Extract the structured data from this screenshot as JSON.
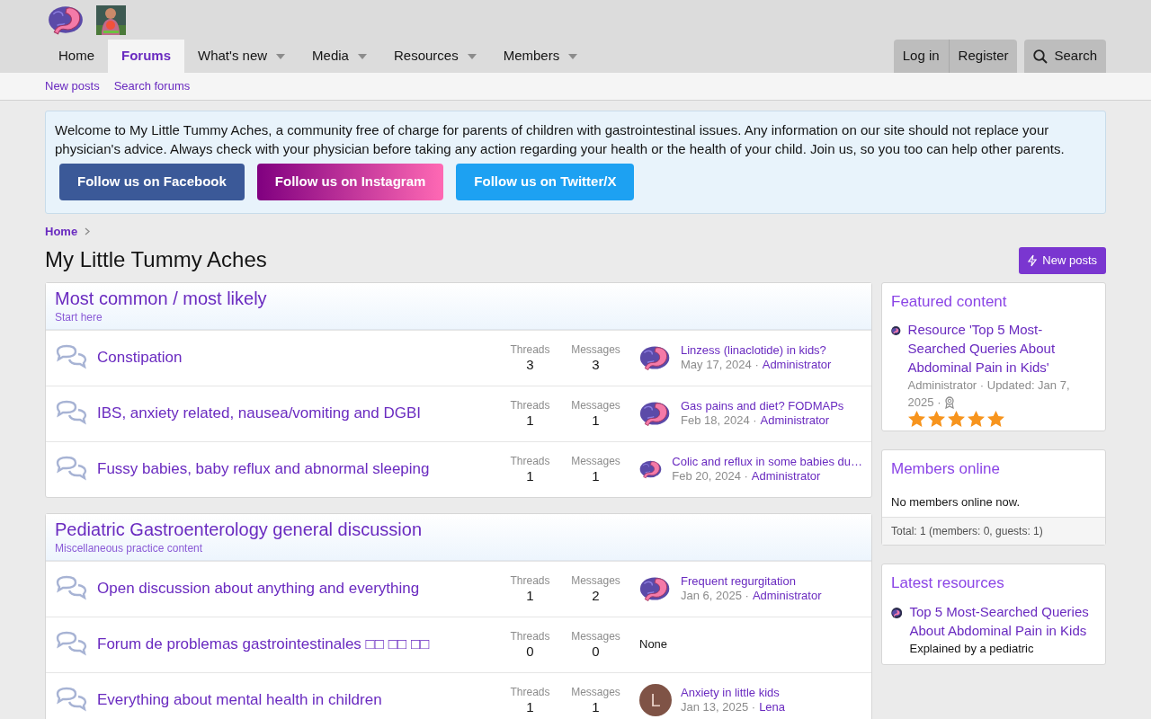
{
  "header": {
    "nav": [
      {
        "label": "Home",
        "selected": false,
        "has_menu": false
      },
      {
        "label": "Forums",
        "selected": true,
        "has_menu": false
      },
      {
        "label": "What's new",
        "selected": false,
        "has_menu": true
      },
      {
        "label": "Media",
        "selected": false,
        "has_menu": true
      },
      {
        "label": "Resources",
        "selected": false,
        "has_menu": true
      },
      {
        "label": "Members",
        "selected": false,
        "has_menu": true
      }
    ],
    "account_buttons": [
      "Log in",
      "Register"
    ],
    "search_button": "Search"
  },
  "subnav": [
    "New posts",
    "Search forums"
  ],
  "notice": {
    "text": "Welcome to My Little Tummy Aches, a community free of charge for parents of children with gastrointestinal issues. Any information on our site should not replace your physician's advice. Always check with your physician before taking any action regarding your health or the health of your child. Join us, so you too can help other parents.",
    "buttons": [
      {
        "label": "Follow us on Facebook",
        "kind": "facebook"
      },
      {
        "label": "Follow us on Instagram",
        "kind": "instagram"
      },
      {
        "label": "Follow us on Twitter/X",
        "kind": "twitter"
      }
    ]
  },
  "breadcrumb": [
    "Home"
  ],
  "page_title": "My Little Tummy Aches",
  "new_posts_button": "New posts",
  "categories": [
    {
      "title": "Most common / most likely",
      "description": "Start here",
      "forums": [
        {
          "title": "Constipation",
          "threads_label": "Threads",
          "threads": "3",
          "messages_label": "Messages",
          "messages": "3",
          "last_post": {
            "title": "Linzess (linaclotide) in kids?",
            "date": "May 17, 2024 ·",
            "author": "Administrator",
            "avatar": {
              "kind": "logo"
            }
          }
        },
        {
          "title": "IBS, anxiety related, nausea/vomiting and DGBI",
          "threads_label": "Threads",
          "threads": "1",
          "messages_label": "Messages",
          "messages": "1",
          "last_post": {
            "title": "Gas pains and diet? FODMAPs",
            "date": "Feb 18, 2024 ·",
            "author": "Administrator",
            "avatar": {
              "kind": "logo"
            }
          }
        },
        {
          "title": "Fussy babies, baby reflux and abnormal sleeping",
          "threads_label": "Threads",
          "threads": "1",
          "messages_label": "Messages",
          "messages": "1",
          "last_post": {
            "title": "Colic and reflux in some babies du…",
            "date": "Feb 20, 2024 ·",
            "author": "Administrator",
            "avatar": {
              "kind": "logo"
            }
          }
        }
      ]
    },
    {
      "title": "Pediatric Gastroenterology general discussion",
      "description": "Miscellaneous practice content",
      "forums": [
        {
          "title": "Open discussion about anything and everything",
          "threads_label": "Threads",
          "threads": "1",
          "messages_label": "Messages",
          "messages": "2",
          "last_post": {
            "title": "Frequent regurgitation",
            "date": "Jan 6, 2025 ·",
            "author": "Administrator",
            "avatar": {
              "kind": "logo"
            }
          }
        },
        {
          "title": "Forum de problemas gastrointestinales □□ □□ □□",
          "threads_label": "Threads",
          "threads": "0",
          "messages_label": "Messages",
          "messages": "0",
          "no_post": "None"
        },
        {
          "title": "Everything about mental health in children",
          "threads_label": "Threads",
          "threads": "1",
          "messages_label": "Messages",
          "messages": "1",
          "last_post": {
            "title": "Anxiety in little kids",
            "date": "Jan 13, 2025 ·",
            "author": "Lena",
            "avatar": {
              "kind": "letter",
              "letter": "L"
            }
          }
        }
      ]
    }
  ],
  "sidebar": {
    "featured": {
      "title": "Featured content",
      "item": {
        "title": "Resource 'Top 5 Most-Searched Queries About Abdominal Pain in Kids'",
        "meta_lines": [
          "Administrator · Updated: Jan 7,",
          "2025 ·"
        ],
        "stars": 5
      }
    },
    "members_online": {
      "title": "Members online",
      "text": "No members online now.",
      "footer": "Total: 1 (members: 0, guests: 1)"
    },
    "latest_resources": {
      "title": "Latest resources",
      "item": {
        "title": "Top 5 Most-Searched Queries About Abdominal Pain in Kids",
        "snippet": "Explained by a pediatric"
      }
    }
  }
}
